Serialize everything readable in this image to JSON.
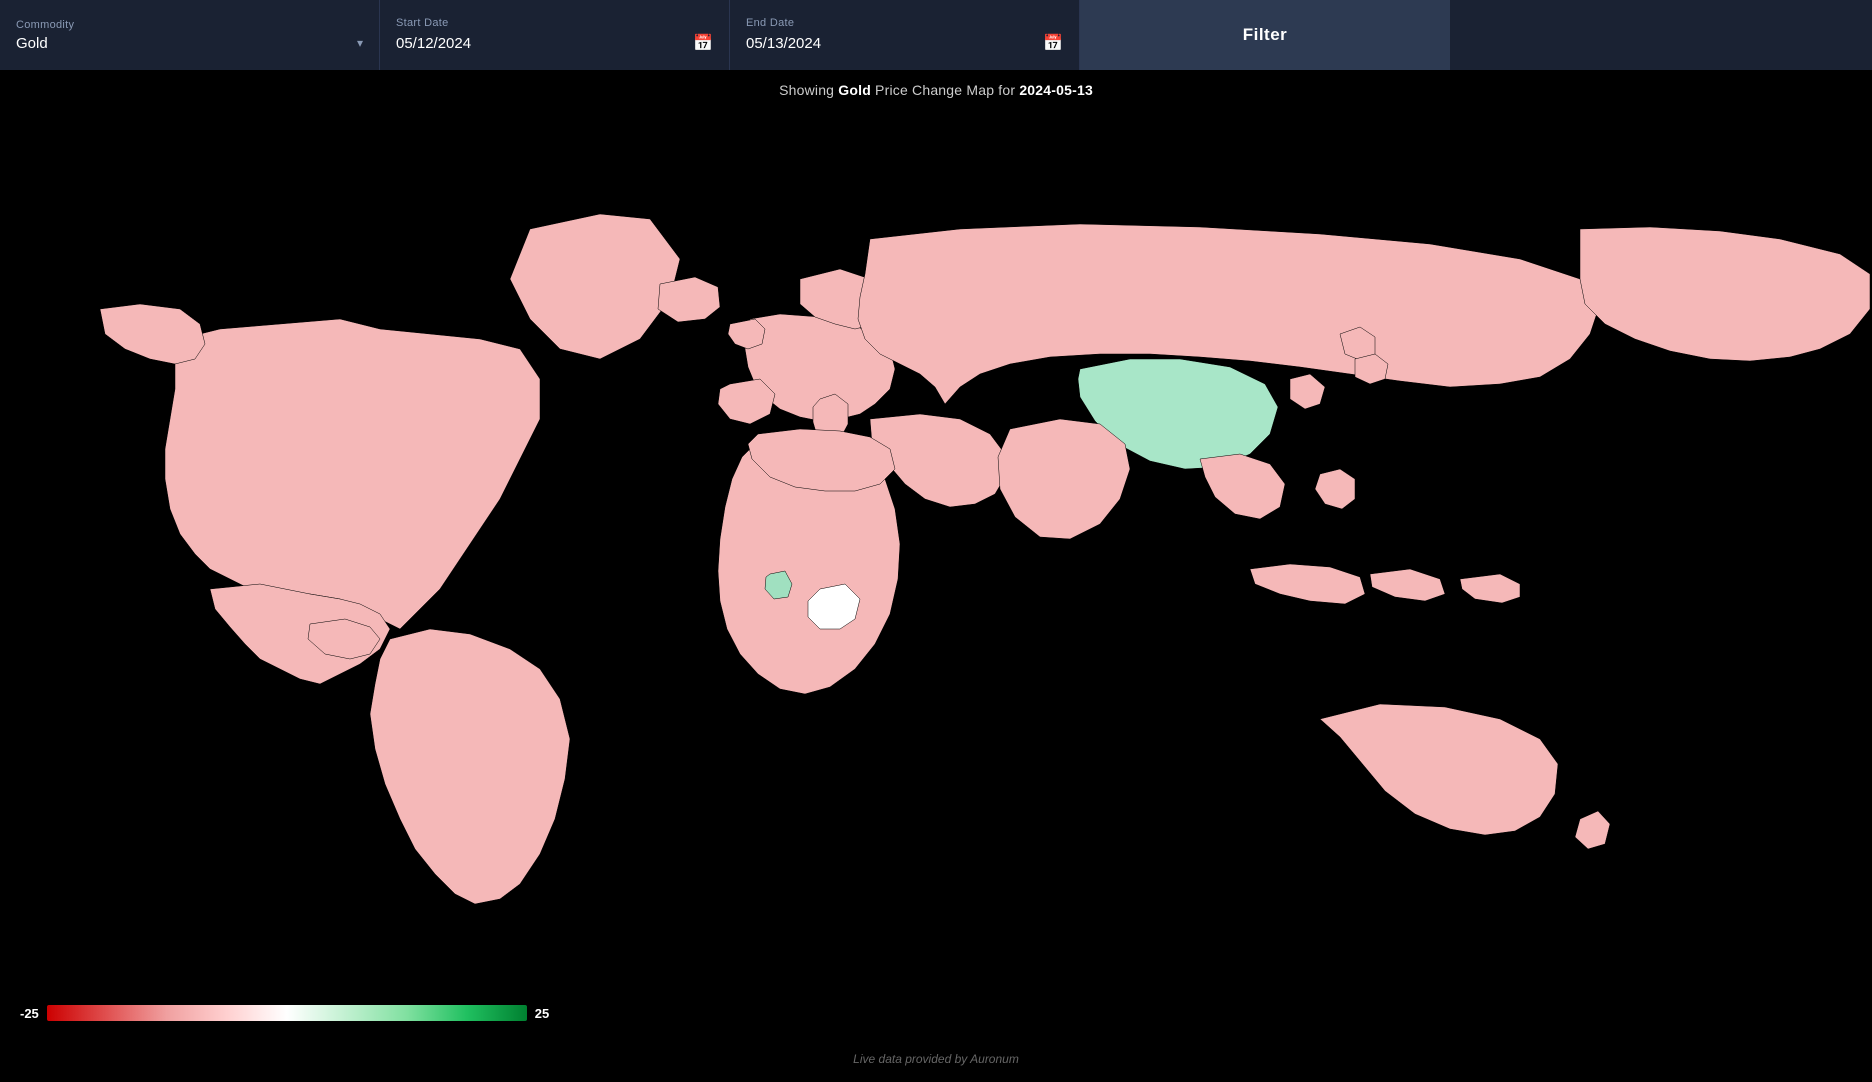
{
  "header": {
    "commodity_label": "Commodity",
    "commodity_value": "Gold",
    "start_date_label": "Start Date",
    "start_date_value": "05/12/2024",
    "end_date_label": "End Date",
    "end_date_value": "05/13/2024",
    "filter_button_label": "Filter"
  },
  "map": {
    "subtitle_prefix": "Showing ",
    "subtitle_commodity": "Gold",
    "subtitle_middle": " Price Change Map for ",
    "subtitle_date": "2024-05-13"
  },
  "legend": {
    "min_label": "-25",
    "max_label": "25"
  },
  "footer": {
    "text": "Live data provided by Auronum"
  },
  "icons": {
    "calendar": "📅",
    "dropdown": "▾"
  }
}
